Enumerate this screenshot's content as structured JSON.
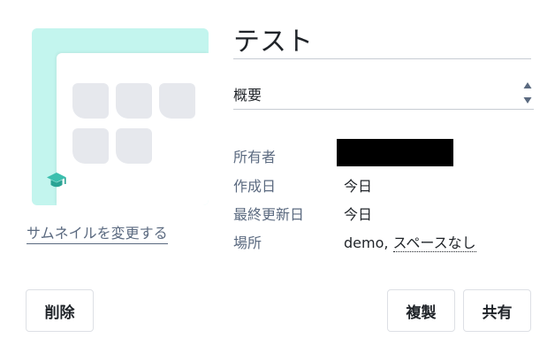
{
  "name_field": {
    "value": "テスト"
  },
  "description_select": {
    "selected": "概要"
  },
  "meta": {
    "owner_label": "所有者",
    "created_label": "作成日",
    "created_value": "今日",
    "updated_label": "最終更新日",
    "updated_value": "今日",
    "location_label": "場所",
    "location_prefix": "demo, ",
    "location_space": "スペースなし"
  },
  "thumbnail": {
    "change_link": "サムネイルを変更する",
    "icon": "graduation-cap-icon",
    "background_color": "#c3f5ee",
    "icon_color": "#3cbfae"
  },
  "actions": {
    "delete_label": "削除",
    "duplicate_label": "複製",
    "share_label": "共有"
  }
}
